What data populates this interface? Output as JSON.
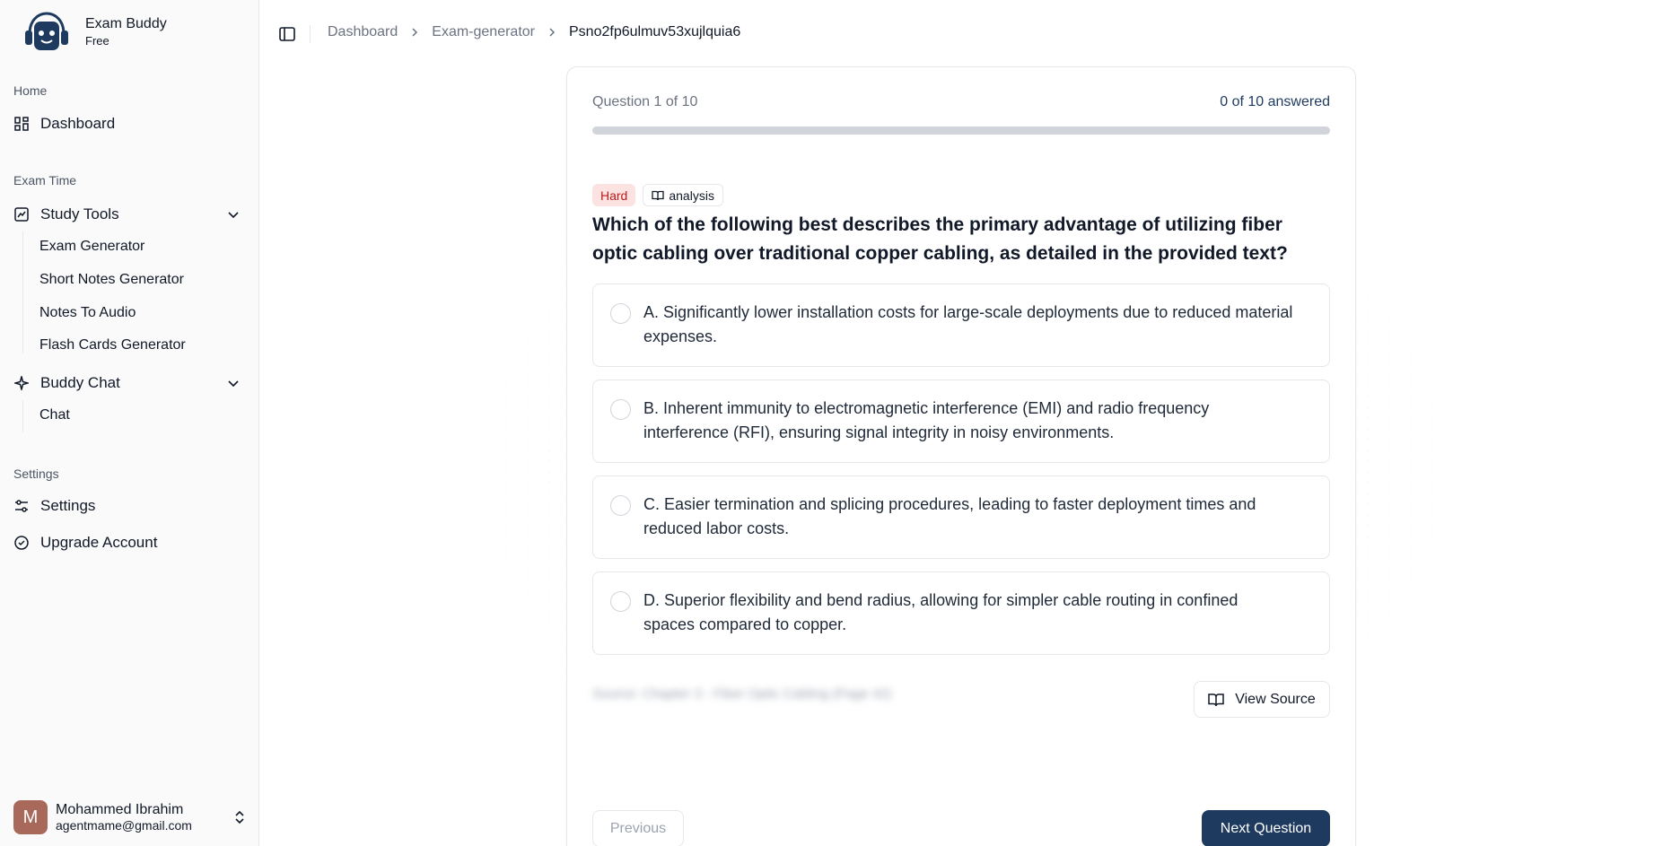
{
  "app": {
    "name": "Exam Buddy",
    "plan": "Free"
  },
  "sidebar": {
    "groups": [
      {
        "label": "Home"
      },
      {
        "label": "Exam Time"
      },
      {
        "label": "Settings"
      }
    ],
    "items": {
      "dashboard": "Dashboard",
      "study_tools": "Study Tools",
      "exam_generator": "Exam Generator",
      "short_notes": "Short Notes Generator",
      "notes_audio": "Notes To Audio",
      "flash_cards": "Flash Cards Generator",
      "buddy_chat": "Buddy Chat",
      "chat": "Chat",
      "settings": "Settings",
      "upgrade": "Upgrade Account"
    },
    "user": {
      "initial": "M",
      "name": "Mohammed Ibrahim",
      "email": "agentmame@gmail.com"
    }
  },
  "breadcrumb": [
    "Dashboard",
    "Exam-generator",
    "Psno2fp6ulmuv53xujlquia6"
  ],
  "quiz": {
    "question_counter": "Question 1 of 10",
    "answered": "0 of 10 answered",
    "progress": 0,
    "difficulty": "Hard",
    "topic": "analysis",
    "question": "Which of the following best describes the primary advantage of utilizing fiber optic cabling over traditional copper cabling, as detailed in the provided text?",
    "options": [
      "A. Significantly lower installation costs for large-scale deployments due to reduced material expenses.",
      "B. Inherent immunity to electromagnetic interference (EMI) and radio frequency interference (RFI), ensuring signal integrity in noisy environments.",
      "C. Easier termination and splicing procedures, leading to faster deployment times and reduced labor costs.",
      "D. Superior flexibility and bend radius, allowing for simpler cable routing in confined spaces compared to copper."
    ],
    "source_ref": "Source: Chapter 3 - Fiber Optic Cabling (Page 42)",
    "view_source": "View Source",
    "previous": "Previous",
    "next": "Next Question"
  },
  "colors": {
    "accent": "#1e3a5f",
    "hard_bg": "#fde2e2",
    "hard_text": "#b91c1c"
  }
}
